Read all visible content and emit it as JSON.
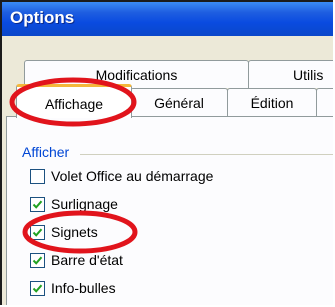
{
  "window": {
    "title": "Options"
  },
  "tabs": {
    "row1": [
      "Modifications",
      "Utilis"
    ],
    "row2": [
      "Affichage",
      "Général",
      "Édition"
    ],
    "active": "Affichage"
  },
  "group": {
    "label": "Afficher"
  },
  "options": [
    {
      "label": "Volet Office au démarrage",
      "checked": false
    },
    {
      "label": "Surlignage",
      "checked": true
    },
    {
      "label": "Signets",
      "checked": true
    },
    {
      "label": "Barre d'état",
      "checked": true
    },
    {
      "label": "Info-bulles",
      "checked": true
    }
  ],
  "colors": {
    "titlebar": "#0a4be0",
    "highlight_ellipse": "#e1141c",
    "group_label": "#0046d5",
    "checkmark": "#21a121"
  }
}
